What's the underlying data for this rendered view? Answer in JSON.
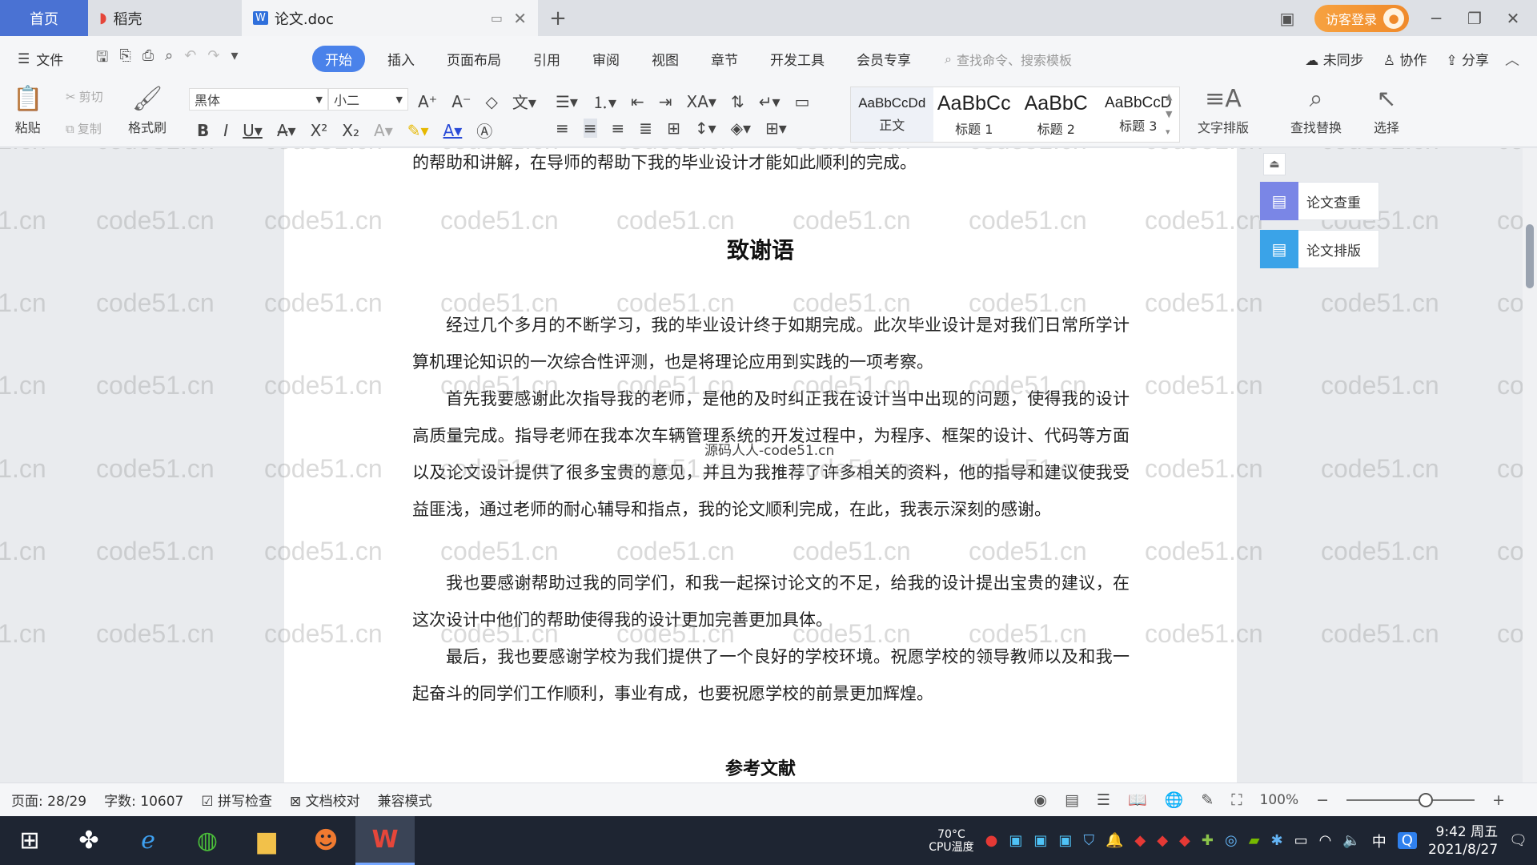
{
  "tabs": {
    "home": "首页",
    "wps": "稻壳",
    "doc": "论文.doc",
    "login": "访客登录"
  },
  "menu": {
    "file": "文件",
    "items": [
      "开始",
      "插入",
      "页面布局",
      "引用",
      "审阅",
      "视图",
      "章节",
      "开发工具",
      "会员专享"
    ],
    "search_placeholder": "查找命令、搜索模板",
    "sync": "未同步",
    "collab": "协作",
    "share": "分享"
  },
  "ribbon": {
    "paste": "粘贴",
    "cut": "剪切",
    "copy": "复制",
    "format_painter": "格式刷",
    "font_name": "黑体",
    "font_size": "小二",
    "styles": [
      {
        "sample": "AaBbCcDd",
        "label": "正文"
      },
      {
        "sample": "AaBbCc",
        "label": "标题 1"
      },
      {
        "sample": "AaBbC",
        "label": "标题 2"
      },
      {
        "sample": "AaBbCcD",
        "label": "标题 3"
      }
    ],
    "text_layout": "文字排版",
    "find_replace": "查找替换",
    "select": "选择"
  },
  "document": {
    "prev_line": "的帮助和讲解，在导师的帮助下我的毕业设计才能如此顺利的完成。",
    "heading": "致谢语",
    "paragraphs": [
      "经过几个多月的不断学习，我的毕业设计终于如期完成。此次毕业设计是对我们日常所学计算机理论知识的一次综合性评测，也是将理论应用到实践的一项考察。",
      "首先我要感谢此次指导我的老师，是他的及时纠正我在设计当中出现的问题，使得我的设计高质量完成。指导老师在我本次车辆管理系统的开发过程中，为程序、框架的设计、代码等方面以及论文设计提供了很多宝贵的意见，并且为我推荐了许多相关的资料，他的指导和建议使我受益匪浅，通过老师的耐心辅导和指点，我的论文顺利完成，在此，我表示深刻的感谢。",
      "我也要感谢帮助过我的同学们，和我一起探讨论文的不足，给我的设计提出宝贵的建议，在这次设计中他们的帮助使得我的设计更加完善更加具体。",
      "最后，我也要感谢学校为我们提供了一个良好的学校环境。祝愿学校的领导教师以及和我一起奋斗的同学们工作顺利，事业有成，也要祝愿学校的前景更加辉煌。"
    ],
    "next_heading": "参考文献",
    "overlay_watermark": "源码人人-code51.cn",
    "watermark": "code51.cn"
  },
  "side_panel": {
    "check": "论文查重",
    "layout": "论文排版"
  },
  "status": {
    "page": "页面: 28/29",
    "words": "字数: 10607",
    "spell": "拼写检查",
    "proof": "文档校对",
    "compat": "兼容模式",
    "zoom": "100%",
    "zoom_level": 0.62
  },
  "taskbar": {
    "cpu_temp": "70°C",
    "cpu_label": "CPU温度",
    "ime": "中",
    "time": "9:42 周五",
    "date": "2021/8/27"
  },
  "colors": {
    "accent": "#4a82ea",
    "home_tab": "#4a72d3",
    "login": "#f08a2a"
  }
}
